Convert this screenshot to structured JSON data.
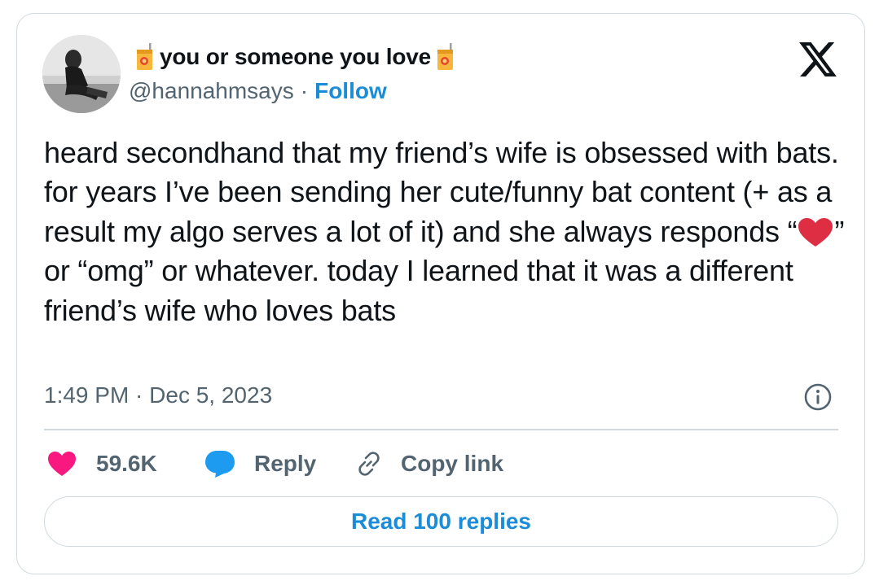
{
  "user": {
    "display_name": "you or someone you love",
    "handle": "@hannahmsays",
    "separator": "·",
    "follow_label": "Follow",
    "name_emoji": "juice-box-icon"
  },
  "tweet": {
    "text_before_heart": "heard secondhand that my friend’s wife is obsessed with bats. for years I’ve been sending her cute/funny bat content (+ as a result my algo serves a lot of it) and she always responds “",
    "text_after_heart": "” or “omg” or whatever.  today I learned that it was a different friend’s wife who loves bats",
    "inline_emoji": "red-heart-icon",
    "timestamp": "1:49 PM · Dec 5, 2023"
  },
  "actions": {
    "like_count": "59.6K",
    "reply_label": "Reply",
    "copy_link_label": "Copy link"
  },
  "read_replies_label": "Read 100 replies",
  "colors": {
    "like": "#f91880",
    "reply": "#1d9bf0",
    "link_blue": "#1a8cd8",
    "secondary_text": "#536471",
    "border": "#cfd9de"
  }
}
